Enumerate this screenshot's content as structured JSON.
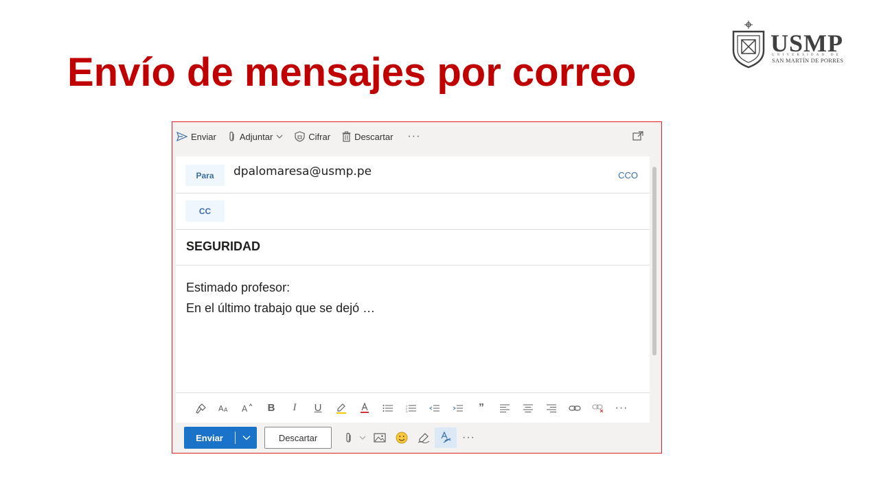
{
  "slide": {
    "title": "Envío de mensajes por correo"
  },
  "logo": {
    "name": "USMP",
    "subtitle": "UNIVERSIDAD DE",
    "subtitle2": "SAN MARTÍN DE PORRES",
    "seal_text": "VERITAS LIBERABIT VOS"
  },
  "toolbar": {
    "send": "Enviar",
    "attach": "Adjuntar",
    "encrypt": "Cifrar",
    "discard": "Descartar",
    "more": "···"
  },
  "compose": {
    "to_label": "Para",
    "to_value": "dpalomaresa@usmp.pe",
    "bcc_label": "CCO",
    "cc_label": "CC",
    "subject": "SEGURIDAD",
    "body_line1": "Estimado profesor:",
    "body_line2": "En el último trabajo que se dejó …"
  },
  "format_bar": {
    "bold": "B",
    "italic": "I",
    "underline": "U",
    "more": "···"
  },
  "bottom_bar": {
    "send": "Enviar",
    "discard": "Descartar",
    "more": "···"
  },
  "colors": {
    "title": "#c00000",
    "accent": "#1a73c8",
    "border": "#e02020"
  }
}
